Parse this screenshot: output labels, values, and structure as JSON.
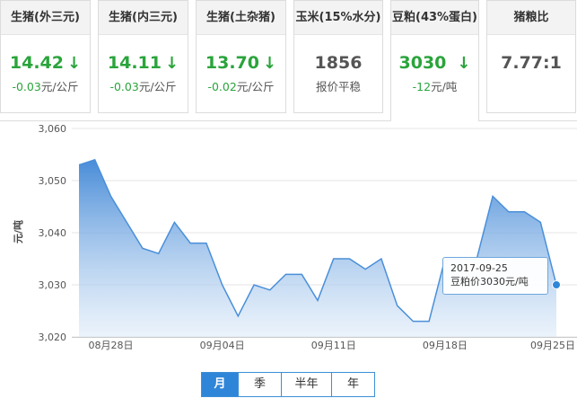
{
  "cards": [
    {
      "title": "生猪(外三元)",
      "value": "14.42",
      "arrow": "↓",
      "change": "-0.03",
      "unit": "元/公斤",
      "color": "#2aa43b"
    },
    {
      "title": "生猪(内三元)",
      "value": "14.11",
      "arrow": "↓",
      "change": "-0.03",
      "unit": "元/公斤",
      "color": "#2aa43b"
    },
    {
      "title": "生猪(土杂猪)",
      "value": "13.70",
      "arrow": "↓",
      "change": "-0.02",
      "unit": "元/公斤",
      "color": "#2aa43b"
    },
    {
      "title": "玉米(15%水分)",
      "value": "1856",
      "arrow": "",
      "status": "报价平稳",
      "color": "#555555"
    },
    {
      "title": "豆粕(43%蛋白)",
      "value": "3030",
      "arrow": "↓",
      "change": "-12",
      "unit": "元/吨",
      "color": "#2aa43b",
      "active": true
    },
    {
      "title": "猪粮比",
      "value": "7.77:1",
      "arrow": "",
      "color": "#555555"
    }
  ],
  "tooltip": {
    "date": "2017-09-25",
    "text": "豆粕价3030元/吨"
  },
  "periods": [
    "月",
    "季",
    "半年",
    "年"
  ],
  "active_period": "月",
  "colors": {
    "line": "#4a8fd9",
    "accent": "#2f86d8",
    "down": "#2aa43b"
  },
  "chart_data": {
    "type": "area",
    "ylabel": "元/吨",
    "ylim": [
      3020,
      3060
    ],
    "yticks": [
      "3,020",
      "3,030",
      "3,040",
      "3,050",
      "3,060"
    ],
    "ytick_values": [
      3020,
      3030,
      3040,
      3050,
      3060
    ],
    "x": [
      "08-26",
      "08-27",
      "08-28",
      "08-29",
      "08-30",
      "08-31",
      "09-01",
      "09-02",
      "09-03",
      "09-04",
      "09-05",
      "09-06",
      "09-07",
      "09-08",
      "09-09",
      "09-10",
      "09-11",
      "09-12",
      "09-13",
      "09-14",
      "09-15",
      "09-16",
      "09-17",
      "09-18",
      "09-19",
      "09-20",
      "09-21",
      "09-22",
      "09-23",
      "09-24",
      "09-25"
    ],
    "values": [
      3053,
      3054,
      3047,
      3042,
      3037,
      3036,
      3042,
      3038,
      3038,
      3030,
      3024,
      3030,
      3029,
      3032,
      3032,
      3027,
      3035,
      3035,
      3033,
      3035,
      3026,
      3023,
      3023,
      3035,
      3035,
      3035,
      3047,
      3044,
      3044,
      3042,
      3030
    ],
    "xtick_labels": [
      "08月28日",
      "09月04日",
      "09月11日",
      "09月18日",
      "09月25日"
    ],
    "xtick_index": [
      2,
      9,
      16,
      23,
      30
    ],
    "grid": true,
    "legend": "none"
  }
}
